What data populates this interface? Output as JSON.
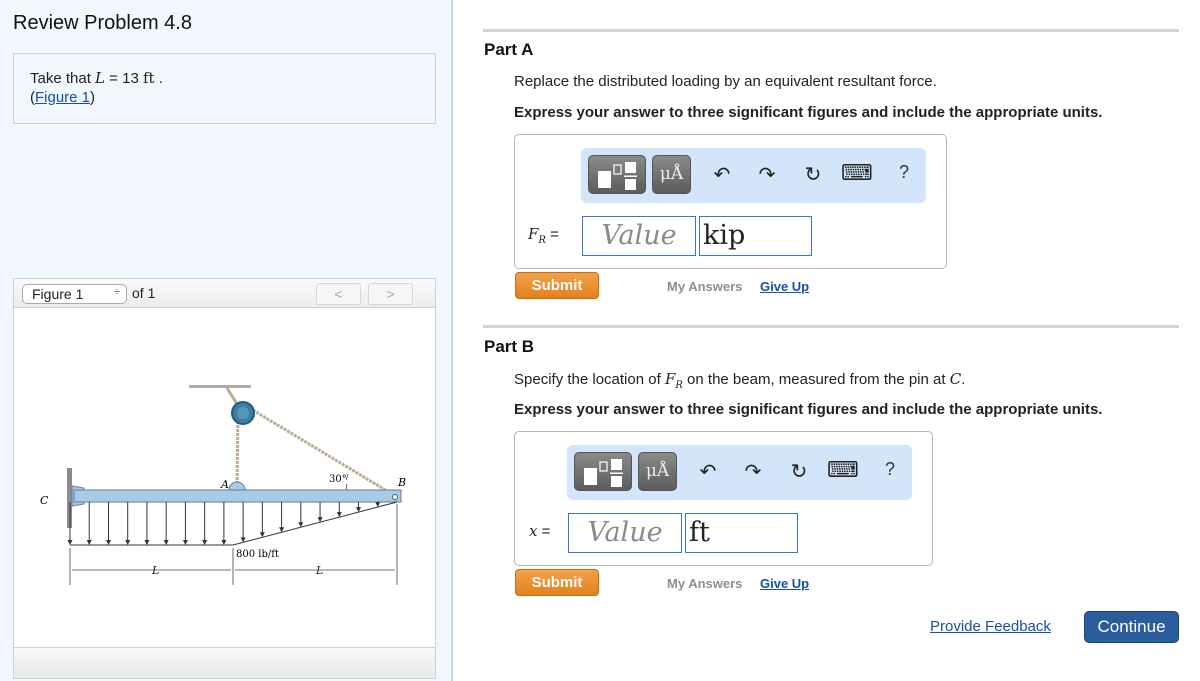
{
  "problem": {
    "title": "Review Problem 4.8",
    "intro_prefix": "Take that",
    "intro_var": "L",
    "intro_eq": " = 13 ",
    "intro_unit": "ft",
    "intro_suffix": " .",
    "figure_link_open": "(",
    "figure_link": "Figure 1",
    "figure_link_close": ")"
  },
  "figure_viewer": {
    "selected": "Figure 1",
    "select_arrows": "÷",
    "of_label": "of 1",
    "prev": "<",
    "next": ">",
    "labels": {
      "C": "C",
      "A": "A",
      "B": "B",
      "angle": "30°",
      "load": "800 lb/ft",
      "L1": "L",
      "L2": "L"
    },
    "colors": {
      "beam": "#a8cbe8",
      "pulley": "#3a7fa5",
      "rope": "#b9ad94"
    }
  },
  "parts": [
    {
      "title": "Part A",
      "instruction": "Replace the distributed loading by an equivalent resultant force.",
      "format_note": "Express your answer to three significant figures and include the appropriate units.",
      "eq_var": "F",
      "eq_sub": "R",
      "eq_sign": " =",
      "value_placeholder": "Value",
      "unit_value": "kip",
      "submit": "Submit",
      "my_answers": "My Answers",
      "give_up": "Give Up"
    },
    {
      "title": "Part B",
      "instruction_prefix": "Specify the location of ",
      "instruction_var": "F",
      "instruction_sub": "R",
      "instruction_mid": " on the beam, measured from the pin at ",
      "instruction_pin": "C",
      "instruction_end": ".",
      "format_note": "Express your answer to three significant figures and include the appropriate units.",
      "eq_var": "x",
      "eq_sign": " =",
      "value_placeholder": "Value",
      "unit_value": "ft",
      "submit": "Submit",
      "my_answers": "My Answers",
      "give_up": "Give Up"
    }
  ],
  "toolbar": {
    "templates_icon": "templates-icon",
    "units_label": "μÅ",
    "undo": "↶",
    "redo": "↷",
    "reset": "↻",
    "keyboard": "⌨",
    "help": "?"
  },
  "footer": {
    "feedback": "Provide Feedback",
    "continue": "Continue"
  }
}
